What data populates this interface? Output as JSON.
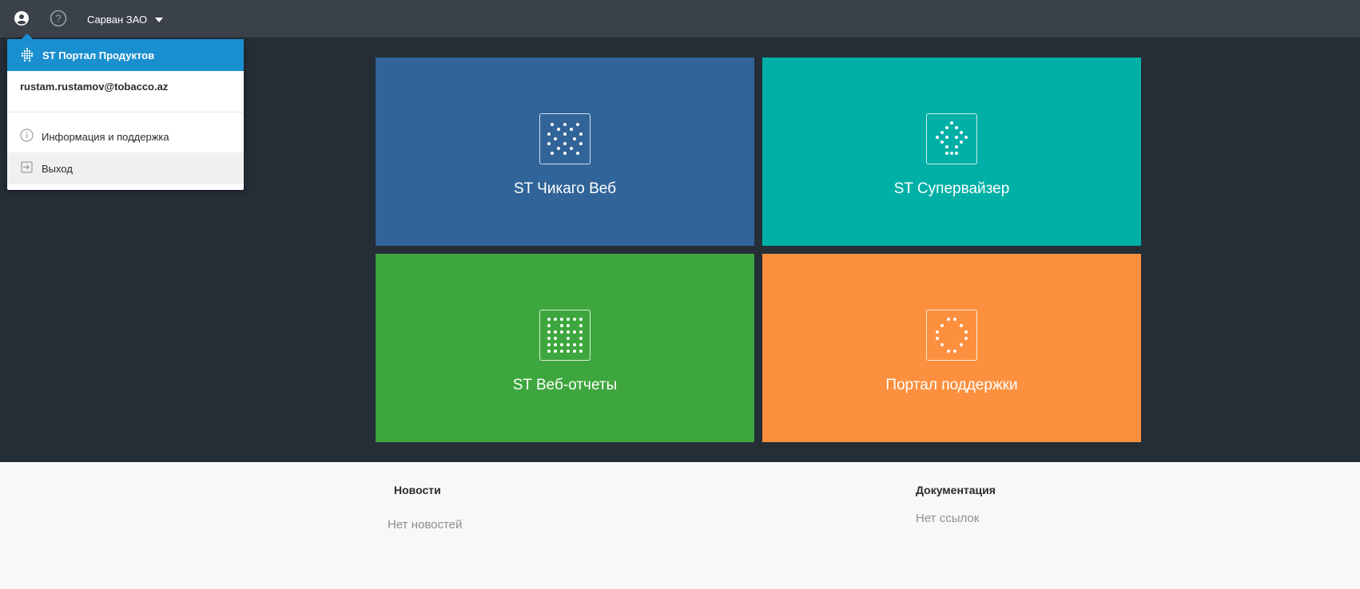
{
  "topbar": {
    "user_icon": "user-circle-icon",
    "help_icon": "question-circle-icon",
    "org_name": "Сарван ЗАО"
  },
  "tiles": [
    {
      "label": "ST Чикаго Веб",
      "color": "#316499",
      "icon": "chicago-dots-icon"
    },
    {
      "label": "ST Супервайзер",
      "color": "#00afa6",
      "icon": "supervisor-dots-icon"
    },
    {
      "label": "ST Веб-отчеты",
      "color": "#3ea63e",
      "icon": "reports-dots-icon"
    },
    {
      "label": "Портал поддержки",
      "color": "#fd903e",
      "icon": "support-dots-icon"
    }
  ],
  "bottom": {
    "news_title": "Новости",
    "news_empty": "Нет новостей",
    "docs_title": "Документация",
    "docs_empty": "Нет ссылок"
  },
  "dropdown": {
    "header": "ST Портал Продуктов",
    "email": "rustam.rustamov@tobacco.az",
    "items": [
      {
        "label": "Информация и поддержка",
        "icon": "info-icon"
      },
      {
        "label": "Выход",
        "icon": "logout-icon"
      }
    ]
  }
}
